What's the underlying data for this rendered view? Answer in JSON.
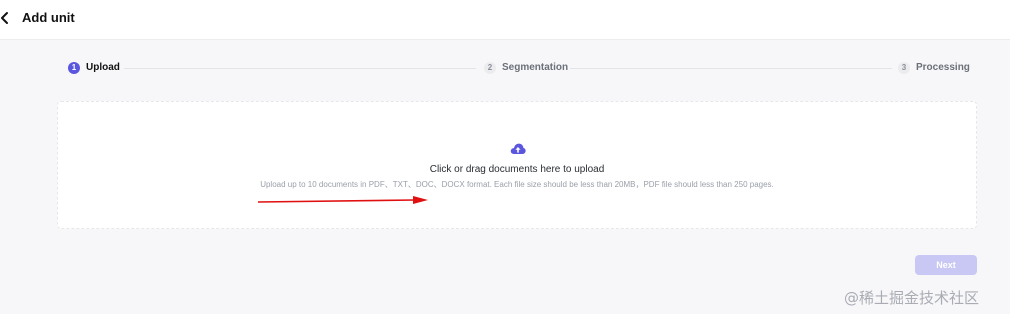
{
  "header": {
    "title": "Add unit",
    "back_icon": "chevron-left-icon"
  },
  "steps": [
    {
      "number": "1",
      "label": "Upload",
      "active": true
    },
    {
      "number": "2",
      "label": "Segmentation",
      "active": false
    },
    {
      "number": "3",
      "label": "Processing",
      "active": false
    }
  ],
  "upload": {
    "icon": "cloud-upload-icon",
    "title": "Click or drag documents here to upload",
    "hint": "Upload up to 10 documents in PDF、TXT、DOC、DOCX format. Each file size should be less than 20MB，PDF file should less than 250 pages."
  },
  "footer": {
    "next_label": "Next"
  },
  "watermark": "@稀土掘金技术社区",
  "colors": {
    "accent": "#5b56e0",
    "next_disabled": "#c9c8f5",
    "annotation_arrow": "#e01010"
  }
}
